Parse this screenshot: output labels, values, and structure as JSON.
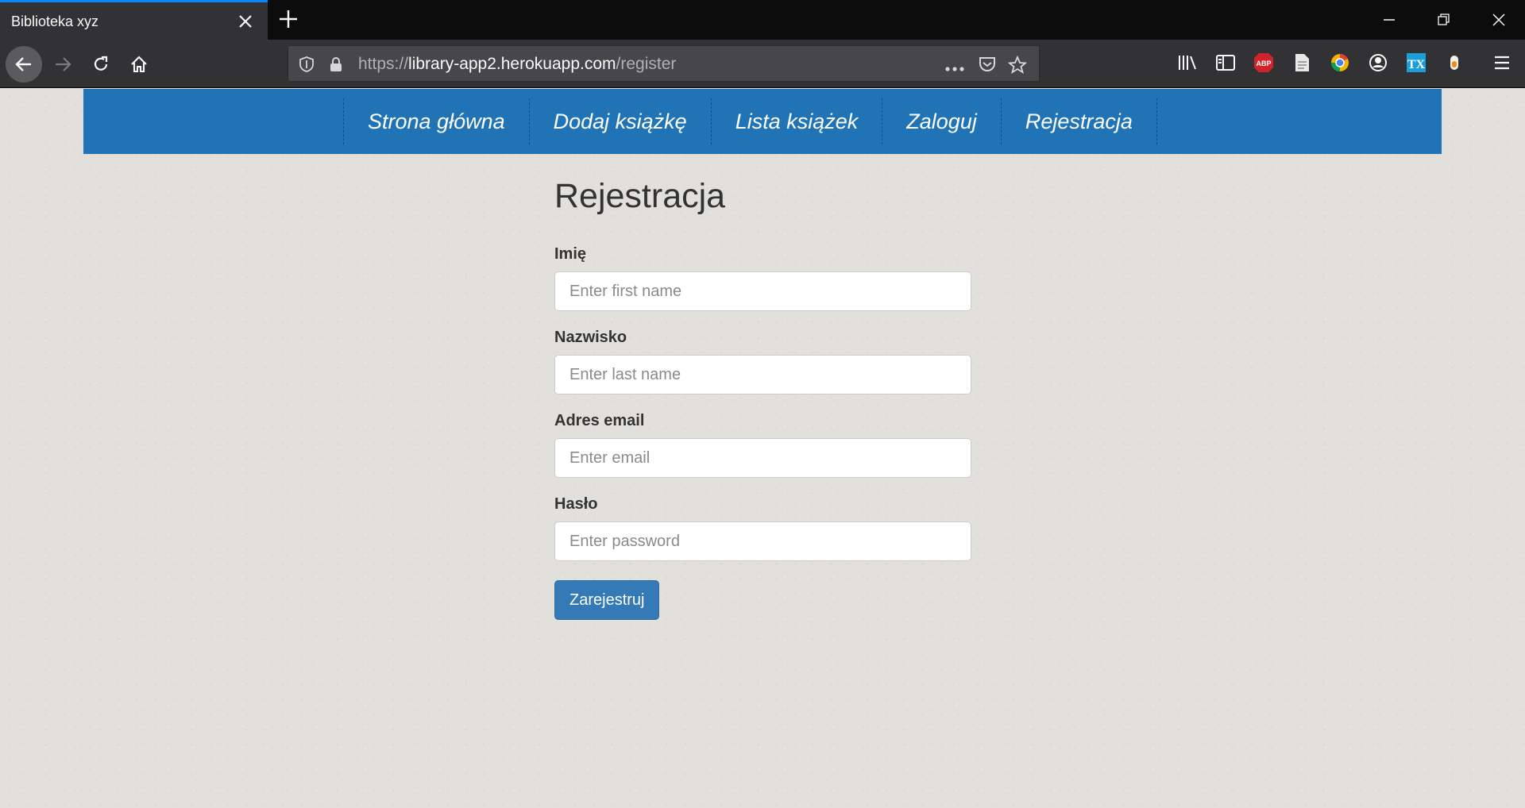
{
  "browser": {
    "tab_title": "Biblioteka xyz",
    "url_prefix": "https://",
    "url_host": "library-app2.herokuapp.com",
    "url_path": "/register",
    "extensions": [
      "library-icon",
      "sidebar-icon",
      "adblock-plus-icon",
      "document-icon",
      "chrome-like-icon",
      "account-icon",
      "tx-icon",
      "pencil-extension-icon"
    ],
    "abp_label": "ABP",
    "tx_label": "TX"
  },
  "site_nav": {
    "items": [
      {
        "label": "Strona główna"
      },
      {
        "label": "Dodaj książkę"
      },
      {
        "label": "Lista książek"
      },
      {
        "label": "Zaloguj"
      },
      {
        "label": "Rejestracja"
      }
    ]
  },
  "form": {
    "title": "Rejestracja",
    "fields": [
      {
        "label": "Imię",
        "placeholder": "Enter first name"
      },
      {
        "label": "Nazwisko",
        "placeholder": "Enter last name"
      },
      {
        "label": "Adres email",
        "placeholder": "Enter email"
      },
      {
        "label": "Hasło",
        "placeholder": "Enter password"
      }
    ],
    "submit_label": "Zarejestruj"
  },
  "colors": {
    "nav_blue": "#2074b6",
    "button_blue": "#337ab7",
    "page_bg": "#e2e0db",
    "tab_accent": "#0a84ff"
  }
}
